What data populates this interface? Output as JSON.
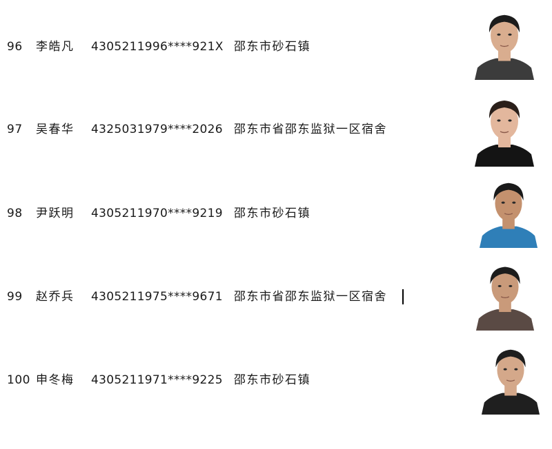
{
  "entries": [
    {
      "number": "96",
      "name": "李皓凡",
      "id_number": "4305211996****921X",
      "address": "邵东市砂石镇",
      "photo": {
        "skin": "#d9ad8f",
        "hair": "#1c1c1c",
        "shirt": "#3c3c3c"
      }
    },
    {
      "number": "97",
      "name": "吴春华",
      "id_number": "4325031979****2026",
      "address": "邵东市省邵东监狱一区宿舍",
      "photo": {
        "skin": "#e3b79d",
        "hair": "#2a1f1a",
        "shirt": "#141414"
      }
    },
    {
      "number": "98",
      "name": "尹跃明",
      "id_number": "4305211970****9219",
      "address": "邵东市砂石镇",
      "photo": {
        "skin": "#c4916e",
        "hair": "#1a1a1a",
        "shirt": "#2f7fb8"
      }
    },
    {
      "number": "99",
      "name": "赵乔兵",
      "id_number": "4305211975****9671",
      "address": "邵东市省邵东监狱一区宿舍",
      "photo": {
        "skin": "#c99a7a",
        "hair": "#1c1c1c",
        "shirt": "#5a4a44"
      }
    },
    {
      "number": "100",
      "name": "申冬梅",
      "id_number": "4305211971****9225",
      "address": "邵东市砂石镇",
      "photo": {
        "skin": "#d4a88a",
        "hair": "#1e1e1e",
        "shirt": "#1f1f1f"
      }
    }
  ]
}
